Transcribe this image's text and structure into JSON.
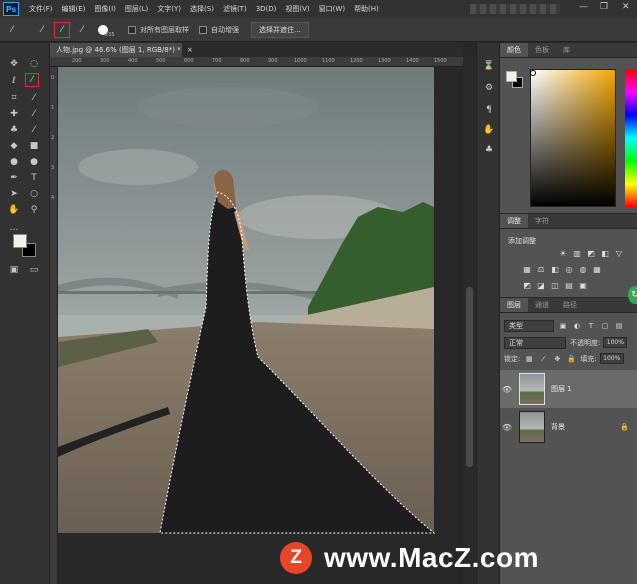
{
  "app": {
    "logo": "Ps"
  },
  "menu": [
    "文件(F)",
    "编辑(E)",
    "图像(I)",
    "图层(L)",
    "文字(Y)",
    "选择(S)",
    "滤镜(T)",
    "3D(D)",
    "视图(V)",
    "窗口(W)",
    "帮助(H)"
  ],
  "window_controls": {
    "minimize": "—",
    "restore": "❐",
    "close": "✕"
  },
  "options": {
    "brush_size": "235",
    "sample_all_label": "对所有图层取样",
    "auto_enhance_label": "自动增强",
    "select_mask_button": "选择并遮住..."
  },
  "document": {
    "tab_title": "人物.jpg @ 46.6% (图层 1, RGB/8*) *",
    "close": "×"
  },
  "ruler": {
    "h_ticks": [
      "200",
      "300",
      "400",
      "500",
      "600",
      "700",
      "800",
      "900",
      "1000",
      "1100",
      "1200",
      "1300",
      "1400",
      "1500"
    ],
    "v_ticks": [
      "0",
      "1",
      "2",
      "3",
      "4"
    ]
  },
  "panels": {
    "color_tabs": [
      "颜色",
      "色板",
      "库"
    ],
    "adjust_tabs": [
      "调整",
      "字符"
    ],
    "adjust_title": "添加调整",
    "layers_tabs": [
      "图层",
      "通道",
      "路径"
    ]
  },
  "layers": {
    "filter_kind": "类型",
    "blend_mode": "正常",
    "opacity_label": "不透明度:",
    "opacity_value": "100%",
    "lock_label": "锁定:",
    "fill_label": "填充:",
    "fill_value": "100%",
    "items": [
      {
        "name": "图层 1",
        "selected": true
      },
      {
        "name": "背景",
        "selected": false
      }
    ]
  },
  "watermark": {
    "logo_letter": "Z",
    "text": "www.MacZ.com"
  },
  "colors": {
    "foreground": "#f4efe8",
    "background": "#000000",
    "highlight": "#dd3333"
  }
}
